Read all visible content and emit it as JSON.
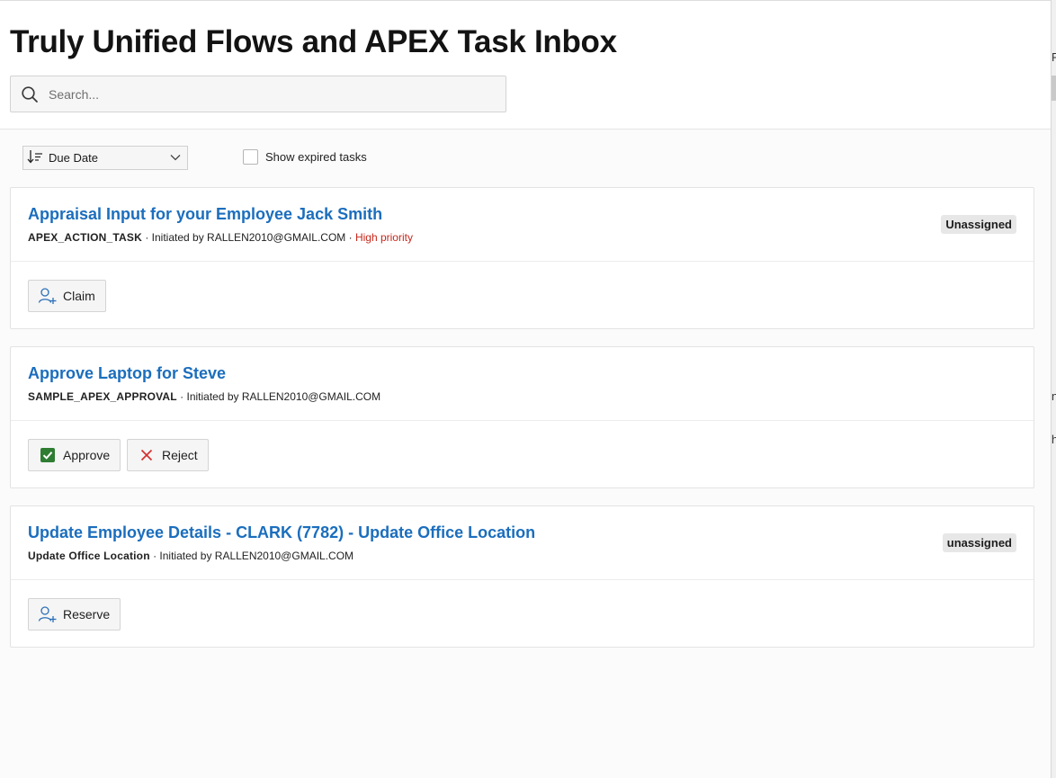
{
  "page": {
    "title": "Truly Unified Flows and APEX Task Inbox"
  },
  "search": {
    "placeholder": "Search...",
    "icon": "search-icon"
  },
  "toolbar": {
    "sort_label": "Due Date",
    "show_expired_label": "Show expired tasks",
    "show_expired_checked": false
  },
  "tasks": [
    {
      "title": "Appraisal Input for your Employee Jack Smith",
      "type": "APEX_ACTION_TASK",
      "initiated": "Initiated by RALLEN2010@GMAIL.COM",
      "priority": "High priority",
      "badge": "Unassigned",
      "actions": [
        {
          "label": "Claim",
          "icon": "person-add-icon"
        }
      ]
    },
    {
      "title": "Approve Laptop for Steve",
      "type": "SAMPLE_APEX_APPROVAL",
      "initiated": "Initiated by RALLEN2010@GMAIL.COM",
      "actions": [
        {
          "label": "Approve",
          "icon": "check-icon"
        },
        {
          "label": "Reject",
          "icon": "close-icon"
        }
      ]
    },
    {
      "title": "Update Employee Details - CLARK (7782) - Update Office Location",
      "type": "Update Office Location",
      "initiated": "Initiated by RALLEN2010@GMAIL.COM",
      "badge": "unassigned",
      "actions": [
        {
          "label": "Reserve",
          "icon": "person-add-icon"
        }
      ]
    }
  ],
  "separator": " · ",
  "colors": {
    "link": "#1b6ebd",
    "priority": "#c7271b",
    "approve": "#2e7d32",
    "reject": "#d32f2f"
  },
  "edge_fragments": [
    "Re",
    "n",
    "h"
  ]
}
